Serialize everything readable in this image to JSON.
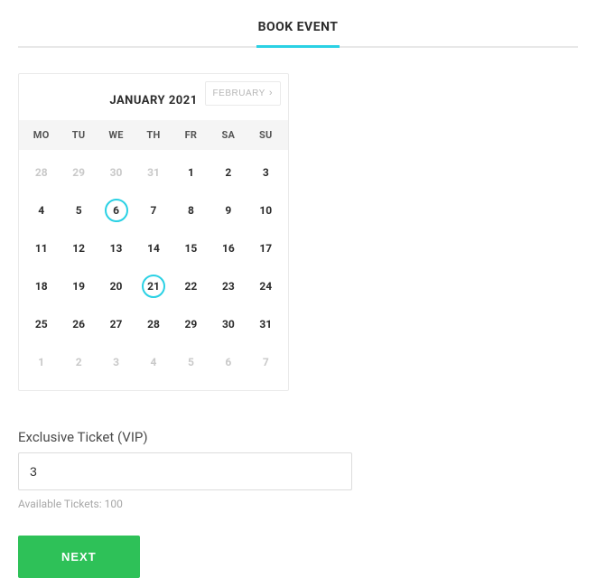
{
  "tab": {
    "label": "BOOK EVENT"
  },
  "calendar": {
    "month_label": "JANUARY 2021",
    "next_month_label": "FEBRUARY",
    "weekdays": [
      "MO",
      "TU",
      "WE",
      "TH",
      "FR",
      "SA",
      "SU"
    ],
    "days": [
      {
        "n": "28",
        "other": true
      },
      {
        "n": "29",
        "other": true
      },
      {
        "n": "30",
        "other": true
      },
      {
        "n": "31",
        "other": true
      },
      {
        "n": "1"
      },
      {
        "n": "2"
      },
      {
        "n": "3"
      },
      {
        "n": "4"
      },
      {
        "n": "5"
      },
      {
        "n": "6",
        "selected": true
      },
      {
        "n": "7"
      },
      {
        "n": "8"
      },
      {
        "n": "9"
      },
      {
        "n": "10"
      },
      {
        "n": "11"
      },
      {
        "n": "12"
      },
      {
        "n": "13"
      },
      {
        "n": "14"
      },
      {
        "n": "15"
      },
      {
        "n": "16"
      },
      {
        "n": "17"
      },
      {
        "n": "18"
      },
      {
        "n": "19"
      },
      {
        "n": "20"
      },
      {
        "n": "21",
        "selected": true
      },
      {
        "n": "22"
      },
      {
        "n": "23"
      },
      {
        "n": "24"
      },
      {
        "n": "25"
      },
      {
        "n": "26"
      },
      {
        "n": "27"
      },
      {
        "n": "28"
      },
      {
        "n": "29"
      },
      {
        "n": "30"
      },
      {
        "n": "31"
      },
      {
        "n": "1",
        "other": true
      },
      {
        "n": "2",
        "other": true
      },
      {
        "n": "3",
        "other": true
      },
      {
        "n": "4",
        "other": true
      },
      {
        "n": "5",
        "other": true
      },
      {
        "n": "6",
        "other": true
      },
      {
        "n": "7",
        "other": true
      }
    ]
  },
  "ticket": {
    "label": "Exclusive Ticket (VIP)",
    "value": "3",
    "available_label": "Available Tickets: 100"
  },
  "actions": {
    "next_label": "NEXT"
  },
  "colors": {
    "accent": "#2ad1e4",
    "primary_button": "#2ec158"
  }
}
